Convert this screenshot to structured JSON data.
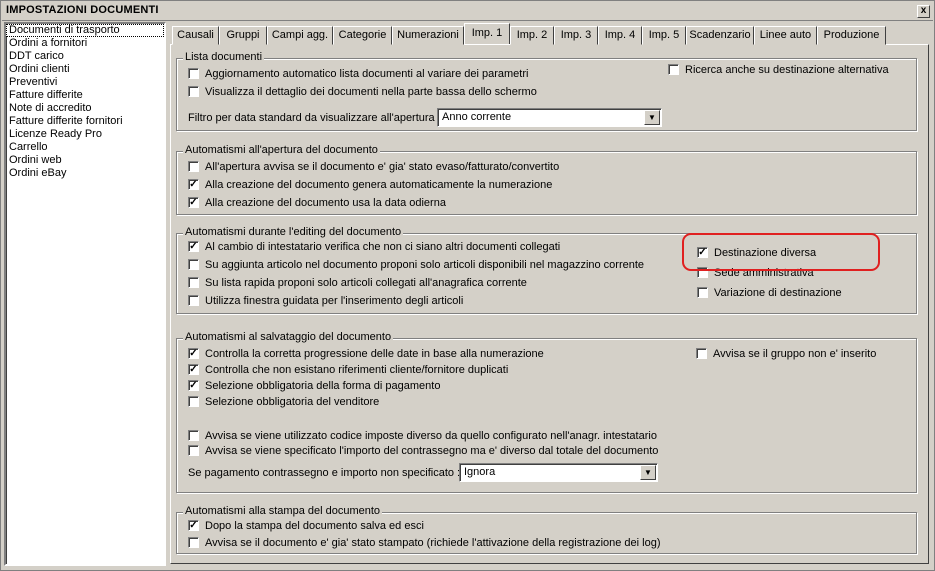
{
  "window": {
    "title": "IMPOSTAZIONI DOCUMENTI",
    "close_label": "x"
  },
  "sidebar": {
    "items": [
      {
        "label": "Documenti di trasporto",
        "selected": true
      },
      {
        "label": "Ordini a fornitori"
      },
      {
        "label": "DDT carico"
      },
      {
        "label": "Ordini clienti"
      },
      {
        "label": "Preventivi"
      },
      {
        "label": "Fatture differite"
      },
      {
        "label": "Note di accredito"
      },
      {
        "label": "Fatture differite fornitori"
      },
      {
        "label": "Licenze Ready Pro"
      },
      {
        "label": "Carrello"
      },
      {
        "label": "Ordini web"
      },
      {
        "label": "Ordini eBay"
      }
    ]
  },
  "tabs": [
    {
      "label": "Causali"
    },
    {
      "label": "Gruppi"
    },
    {
      "label": "Campi agg."
    },
    {
      "label": "Categorie"
    },
    {
      "label": "Numerazioni"
    },
    {
      "label": "Imp. 1",
      "active": true
    },
    {
      "label": "Imp. 2"
    },
    {
      "label": "Imp. 3"
    },
    {
      "label": "Imp. 4"
    },
    {
      "label": "Imp. 5"
    },
    {
      "label": "Scadenzario"
    },
    {
      "label": "Linee auto"
    },
    {
      "label": "Produzione"
    }
  ],
  "groups": {
    "lista": {
      "title": "Lista documenti",
      "cb1": {
        "label": "Aggiornamento automatico lista documenti al variare dei parametri",
        "checked": false
      },
      "cb2": {
        "label": "Visualizza il dettaglio dei documenti nella parte bassa dello schermo",
        "checked": false
      },
      "cb3": {
        "label": "Ricerca anche su destinazione alternativa",
        "checked": false
      },
      "filter_label": "Filtro per data standard da visualizzare all'apertura :",
      "filter_value": "Anno corrente"
    },
    "apertura": {
      "title": "Automatismi all'apertura del documento",
      "cb1": {
        "label": "All'apertura avvisa se il documento e' gia' stato evaso/fatturato/convertito",
        "checked": false
      },
      "cb2": {
        "label": "Alla creazione del documento genera automaticamente la numerazione",
        "checked": true
      },
      "cb3": {
        "label": "Alla creazione del documento usa la data odierna",
        "checked": true
      }
    },
    "editing": {
      "title": "Automatismi durante l'editing del documento",
      "cb1": {
        "label": "Al cambio di intestatario verifica che non ci siano altri documenti collegati",
        "checked": true
      },
      "cb2": {
        "label": "Su aggiunta articolo nel documento proponi solo articoli disponibili nel magazzino corrente",
        "checked": false
      },
      "cb3": {
        "label": "Su lista rapida proponi solo articoli collegati all'anagrafica corrente",
        "checked": false
      },
      "cb4": {
        "label": "Utilizza finestra guidata per l'inserimento degli articoli",
        "checked": false
      },
      "cb5": {
        "label": "Destinazione diversa",
        "checked": true
      },
      "cb6": {
        "label": "Sede amministrativa",
        "checked": false
      },
      "cb7": {
        "label": "Variazione di destinazione",
        "checked": false
      }
    },
    "salvataggio": {
      "title": "Automatismi al salvataggio del documento",
      "cb1": {
        "label": "Controlla la corretta progressione delle date in base alla numerazione",
        "checked": true
      },
      "cb2": {
        "label": "Controlla che non esistano riferimenti cliente/fornitore duplicati",
        "checked": true
      },
      "cb3": {
        "label": "Selezione obbligatoria della forma di pagamento",
        "checked": true
      },
      "cb4": {
        "label": "Selezione obbligatoria del venditore",
        "checked": false
      },
      "cb5": {
        "label": "Avvisa se il gruppo non e' inserito",
        "checked": false
      },
      "cb6": {
        "label": "Avvisa se viene utilizzato codice imposte diverso da quello configurato nell'anagr. intestatario",
        "checked": false
      },
      "cb7": {
        "label": "Avvisa se viene specificato l'importo del contrassegno ma e' diverso dal totale del documento",
        "checked": false
      },
      "pay_label": "Se pagamento contrassegno e importo non specificato :",
      "pay_value": "Ignora"
    },
    "stampa": {
      "title": "Automatismi alla stampa del documento",
      "cb1": {
        "label": "Dopo la stampa del documento salva ed esci",
        "checked": true
      },
      "cb2": {
        "label": "Avvisa se il documento e' gia' stato stampato (richiede l'attivazione della registrazione dei log)",
        "checked": false
      }
    }
  },
  "check_mark": "✓",
  "dropdown_arrow": "▼"
}
